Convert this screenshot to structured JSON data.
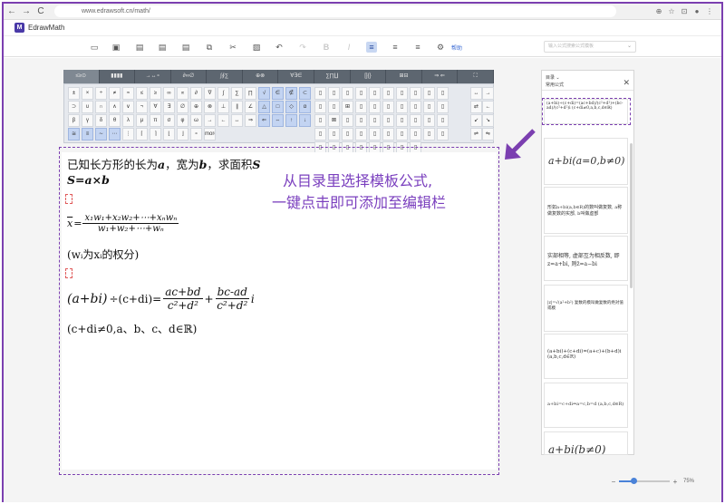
{
  "browser": {
    "back": "←",
    "forward": "→",
    "reload": "C",
    "url": "www.edrawsoft.cn/math/",
    "icons": [
      "⊕",
      "☆",
      "⊡",
      "●",
      "⋮"
    ]
  },
  "app": {
    "logo": "M",
    "title": "EdrawMath"
  },
  "toolbar": {
    "icons": [
      {
        "name": "open-file-icon",
        "glyph": "▭"
      },
      {
        "name": "new-file-icon",
        "glyph": "▣"
      },
      {
        "name": "save-icon",
        "glyph": "▤"
      },
      {
        "name": "save-as-icon",
        "glyph": "▤"
      },
      {
        "name": "export-icon",
        "glyph": "▤"
      },
      {
        "name": "copy-icon",
        "glyph": "⧉"
      },
      {
        "name": "cut-icon",
        "glyph": "✂"
      },
      {
        "name": "paste-icon",
        "glyph": "▨"
      },
      {
        "name": "undo-icon",
        "glyph": "↶"
      },
      {
        "name": "redo-icon",
        "glyph": "↷"
      },
      {
        "name": "bold-icon",
        "glyph": "B"
      },
      {
        "name": "italic-icon",
        "glyph": "I"
      },
      {
        "name": "align-left-icon",
        "glyph": "≡"
      },
      {
        "name": "align-center-icon",
        "glyph": "≡"
      },
      {
        "name": "align-right-icon",
        "glyph": "≡"
      },
      {
        "name": "settings-icon",
        "glyph": "⚙"
      }
    ],
    "link": "帮助",
    "search_placeholder": "输入公式搜索公式模板",
    "search_chevron": "⌄"
  },
  "palette": {
    "tabs": [
      "≤≥⊙",
      "▮▮▮▮",
      "→↔∘",
      "∂∞∅",
      "∫∮∑",
      "⊕⊗",
      "∀∃∈",
      "∑∏∐",
      "[]{}",
      "⊞⊟",
      "⇒ ⇐",
      "⛶"
    ],
    "symbols": [
      "±",
      "×",
      "÷",
      "≠",
      "≈",
      "≤",
      "≥",
      "∞",
      "∝",
      "∂",
      "∇",
      "∫",
      "∑",
      "∏",
      "√",
      "∈",
      "∉",
      "⊂",
      "⊃",
      "∪",
      "∩",
      "∧",
      "∨",
      "¬",
      "∀",
      "∃",
      "∅",
      "⊕",
      "⊗",
      "⊥",
      "∥",
      "∠",
      "△",
      "□",
      "◇",
      "α",
      "β",
      "γ",
      "δ",
      "θ",
      "λ",
      "μ",
      "π",
      "σ",
      "φ",
      "ω",
      "→",
      "←",
      "↔",
      "⇒",
      "⇐",
      "⇔",
      "↑",
      "↓",
      "≅",
      "≡",
      "∼",
      "⋯",
      "⋮",
      "⌈",
      "⌉",
      "⌊",
      "⌋",
      "∘",
      "more"
    ],
    "templates": [
      "▯",
      "▯",
      "▯",
      "▯",
      "▯",
      "▯",
      "▯",
      "▯",
      "▯",
      "▯",
      "▯",
      "▯",
      "⊞",
      "▯",
      "▯",
      "▯",
      "▯",
      "▯",
      "▯",
      "▯",
      "▯",
      "⊠",
      "▯",
      "▯",
      "▯",
      "▯",
      "▯",
      "▯",
      "▯",
      "▯",
      "▯",
      "▯",
      "▯",
      "▯",
      "▯",
      "▯",
      "▯",
      "▯",
      "▯",
      "▯",
      "▯",
      "▯",
      "▯",
      "▯",
      "▯",
      "▯",
      "▯",
      "▯"
    ],
    "arrows": [
      "↔",
      "→",
      "⇄",
      "←",
      "↙",
      "↘",
      "⇌",
      "⇋"
    ]
  },
  "editor": {
    "line1_prefix": "已知长方形的长为",
    "line1_a": "a",
    "line1_mid": "，宽为",
    "line1_b": "b",
    "line1_suffix": "，求面积",
    "line1_s": "S",
    "line2": "S=a×b",
    "xbar": "x",
    "eq": "=",
    "frac1_num": "x₁w₁+x₂w₂+⋯+xₙwₙ",
    "frac1_den": "w₁+w₂+⋯+wₙ",
    "line4": "(wᵢ为xᵢ的权分)",
    "line5_left": "(a+bi)",
    "line5_div": "÷(c+di)=",
    "frac2_num": "ac+bd",
    "frac2_den": "c²+d²",
    "plus": "+",
    "frac3_num": "bc-ad",
    "frac3_den": "c²+d²",
    "i": "i",
    "line6": "(c+di≠0,a、b、c、d∈ℝ)"
  },
  "hint": {
    "line1": "从目录里选择模板公式,",
    "line2": "一键点击即可添加至编辑栏"
  },
  "side_panel": {
    "directory": "目录 ⌄",
    "category": "常用公式",
    "close": "✕",
    "cards": [
      "(a+bi)÷(c+di)=(ac+bd)/(c²+d²)+(bc-ad)/(c²+d²)i (c+di≠0,a,b,c,d∈ℝ)",
      "a+bi(a=0,b≠0)",
      "形如a+bi(a,b∈R)的数叫做复数, a称做复数的实部, b叫做虚部",
      "实部相等, 虚部互为相反数, 即z=a+bi, 则z̄=a−bi",
      "|z|=√(a²+b²) 复数的模叫做复数的绝对值或模",
      "(a+bi)+(c+di)=(a+c)+(b+d)i (a,b,c,d∈R)",
      "a+bi=c+di⇔a=c,b=d (a,b,c,d∈R)",
      "a+bi(b≠0)"
    ]
  },
  "zoom": {
    "minus": "−",
    "plus": "+",
    "value": "75%",
    "level": 0.3
  }
}
